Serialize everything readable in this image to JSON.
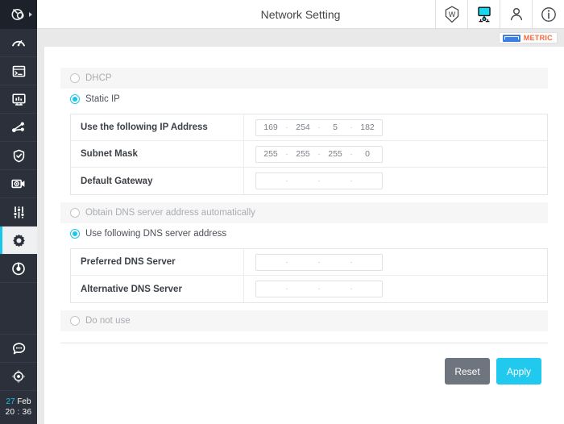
{
  "header": {
    "title": "Network Setting",
    "icons": [
      {
        "name": "w-shield-icon",
        "label": "W"
      },
      {
        "name": "network-monitor-icon",
        "label": ""
      },
      {
        "name": "user-account-icon",
        "label": ""
      },
      {
        "name": "info-icon",
        "label": ""
      }
    ]
  },
  "metric": {
    "label": "METRIC",
    "icon": "ruler-icon",
    "icon_color": "#3f7fe0",
    "text_color": "#f4663a"
  },
  "sidebar": {
    "logo": "app-logo",
    "items": [
      {
        "name": "sidebar-item-dashboard",
        "icon": "gauge-icon",
        "active": false
      },
      {
        "name": "sidebar-item-terminal",
        "icon": "terminal-icon",
        "active": false
      },
      {
        "name": "sidebar-item-monitor",
        "icon": "monitor-chart-icon",
        "active": false
      },
      {
        "name": "sidebar-item-network",
        "icon": "share-nodes-icon",
        "active": false
      },
      {
        "name": "sidebar-item-security",
        "icon": "shield-check-icon",
        "active": false
      },
      {
        "name": "sidebar-item-camera",
        "icon": "camera-gear-icon",
        "active": false
      },
      {
        "name": "sidebar-item-controls",
        "icon": "sliders-icon",
        "active": false
      },
      {
        "name": "sidebar-item-settings",
        "icon": "gear-icon",
        "active": true
      },
      {
        "name": "sidebar-item-target",
        "icon": "target-icon",
        "active": false
      }
    ],
    "bottom_items": [
      {
        "name": "sidebar-item-chat",
        "icon": "chat-bubble-icon"
      },
      {
        "name": "sidebar-item-joystick",
        "icon": "joystick-icon"
      }
    ],
    "clock": {
      "day": "27",
      "month": "Feb",
      "time": "20 : 36",
      "day_color": "#19c7e8"
    }
  },
  "form": {
    "dhcp": {
      "label": "DHCP",
      "checked": false
    },
    "static_ip": {
      "label": "Static IP",
      "checked": true
    },
    "ip_rows": [
      {
        "label": "Use the following IP Address",
        "octets": [
          "169",
          "254",
          "5",
          "182"
        ]
      },
      {
        "label": "Subnet Mask",
        "octets": [
          "255",
          "255",
          "255",
          "0"
        ]
      },
      {
        "label": "Default Gateway",
        "octets": [
          "",
          "",
          "",
          ""
        ]
      }
    ],
    "dns_auto": {
      "label": "Obtain DNS server address automatically",
      "checked": false
    },
    "dns_manual": {
      "label": "Use following DNS server address",
      "checked": true
    },
    "dns_rows": [
      {
        "label": "Preferred DNS Server",
        "octets": [
          "",
          "",
          "",
          ""
        ]
      },
      {
        "label": "Alternative DNS Server",
        "octets": [
          "",
          "",
          "",
          ""
        ]
      }
    ],
    "do_not_use": {
      "label": "Do not use",
      "checked": false
    }
  },
  "actions": {
    "reset_label": "Reset",
    "apply_label": "Apply",
    "reset_color": "#6f757e",
    "apply_color": "#22c9ee"
  }
}
